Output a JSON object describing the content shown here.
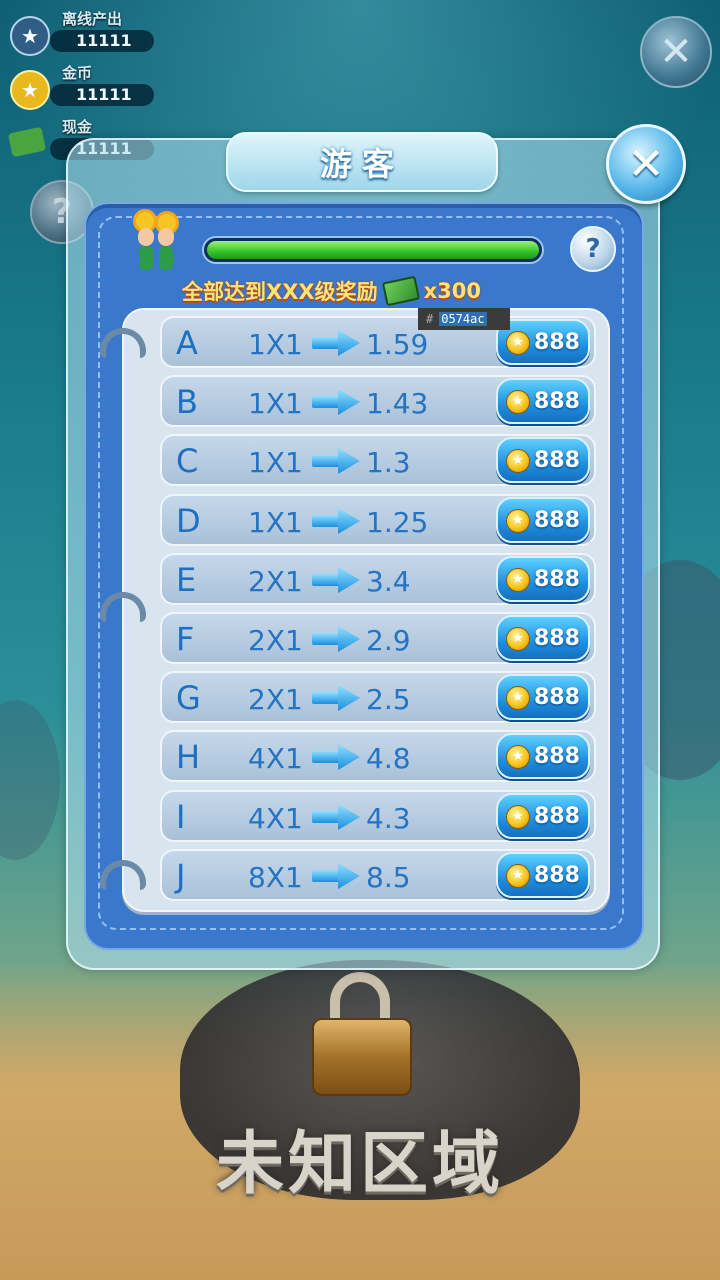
{
  "stats": [
    {
      "label": "离线产出",
      "value": "11111",
      "icon": "star-icon"
    },
    {
      "label": "金币",
      "value": "11111",
      "icon": "coin-icon"
    },
    {
      "label": "现金",
      "value": "11111",
      "icon": "cash-icon"
    }
  ],
  "dialog": {
    "title": "游客",
    "progress": 1.0,
    "reward_text": "全部达到XXX级奖励",
    "reward_amount": "x300",
    "help_glyph": "?",
    "close_glyph": "✕"
  },
  "tooltip": {
    "hash": "#",
    "hex": "0574ac"
  },
  "upgrades": [
    {
      "letter": "A",
      "mult": "1X1",
      "target": "1.59",
      "price": "888"
    },
    {
      "letter": "B",
      "mult": "1X1",
      "target": "1.43",
      "price": "888"
    },
    {
      "letter": "C",
      "mult": "1X1",
      "target": "1.3",
      "price": "888"
    },
    {
      "letter": "D",
      "mult": "1X1",
      "target": "1.25",
      "price": "888"
    },
    {
      "letter": "E",
      "mult": "2X1",
      "target": "3.4",
      "price": "888"
    },
    {
      "letter": "F",
      "mult": "2X1",
      "target": "2.9",
      "price": "888"
    },
    {
      "letter": "G",
      "mult": "2X1",
      "target": "2.5",
      "price": "888"
    },
    {
      "letter": "H",
      "mult": "4X1",
      "target": "4.8",
      "price": "888"
    },
    {
      "letter": "I",
      "mult": "4X1",
      "target": "4.3",
      "price": "888"
    },
    {
      "letter": "J",
      "mult": "8X1",
      "target": "8.5",
      "price": "888"
    }
  ],
  "background": {
    "close_glyph": "✕",
    "help_glyph": "?",
    "locked_area_label": "未知区域"
  },
  "colors": {
    "accent_blue": "#0574ac",
    "progress_green": "#34c22a",
    "reward_gold": "#ffe27a"
  }
}
